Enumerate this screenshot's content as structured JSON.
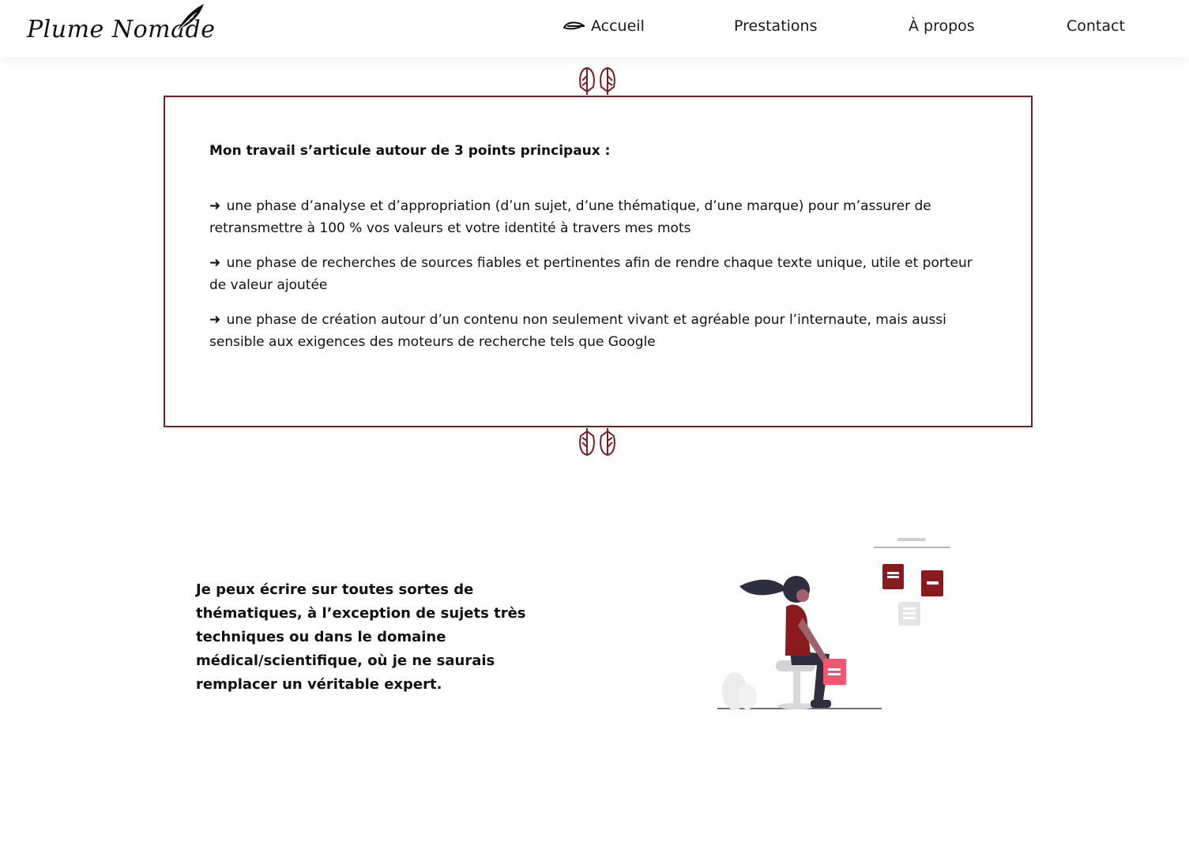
{
  "brand": {
    "logo_text": "Plume Nomade"
  },
  "nav": {
    "items": [
      {
        "label": "Accueil",
        "icon": "feather-pen-icon"
      },
      {
        "label": "Prestations"
      },
      {
        "label": "À propos"
      },
      {
        "label": "Contact"
      }
    ]
  },
  "framed_section": {
    "intro": "Mon travail s’articule autour de 3 points principaux :",
    "arrow_symbol": "➜",
    "points": [
      "une phase d’analyse et d’appropriation (d’un sujet, d’une thématique, d’une marque) pour m’assurer de retransmettre à 100 % vos valeurs et votre identité à travers mes mots",
      "une phase de recherches de sources fiables et pertinentes afin de rendre chaque texte unique, utile et porteur de valeur ajoutée",
      "une phase de création autour d’un contenu non seulement vivant et agréable pour l’internaute, mais aussi sensible aux exigences des moteurs de recherche tels que Google"
    ]
  },
  "topics_section": {
    "text": "Je peux écrire sur toutes sortes de thématiques, à l’exception de sujets très techniques ou dans le domaine médical/scientifique, où je ne saurais remplacer un véritable expert."
  },
  "colors": {
    "accent": "#7a1e22",
    "book_red": "#8b1a1f",
    "book_pink": "#f2556f",
    "grey": "#e0e0e0",
    "navy": "#2f2e41"
  }
}
